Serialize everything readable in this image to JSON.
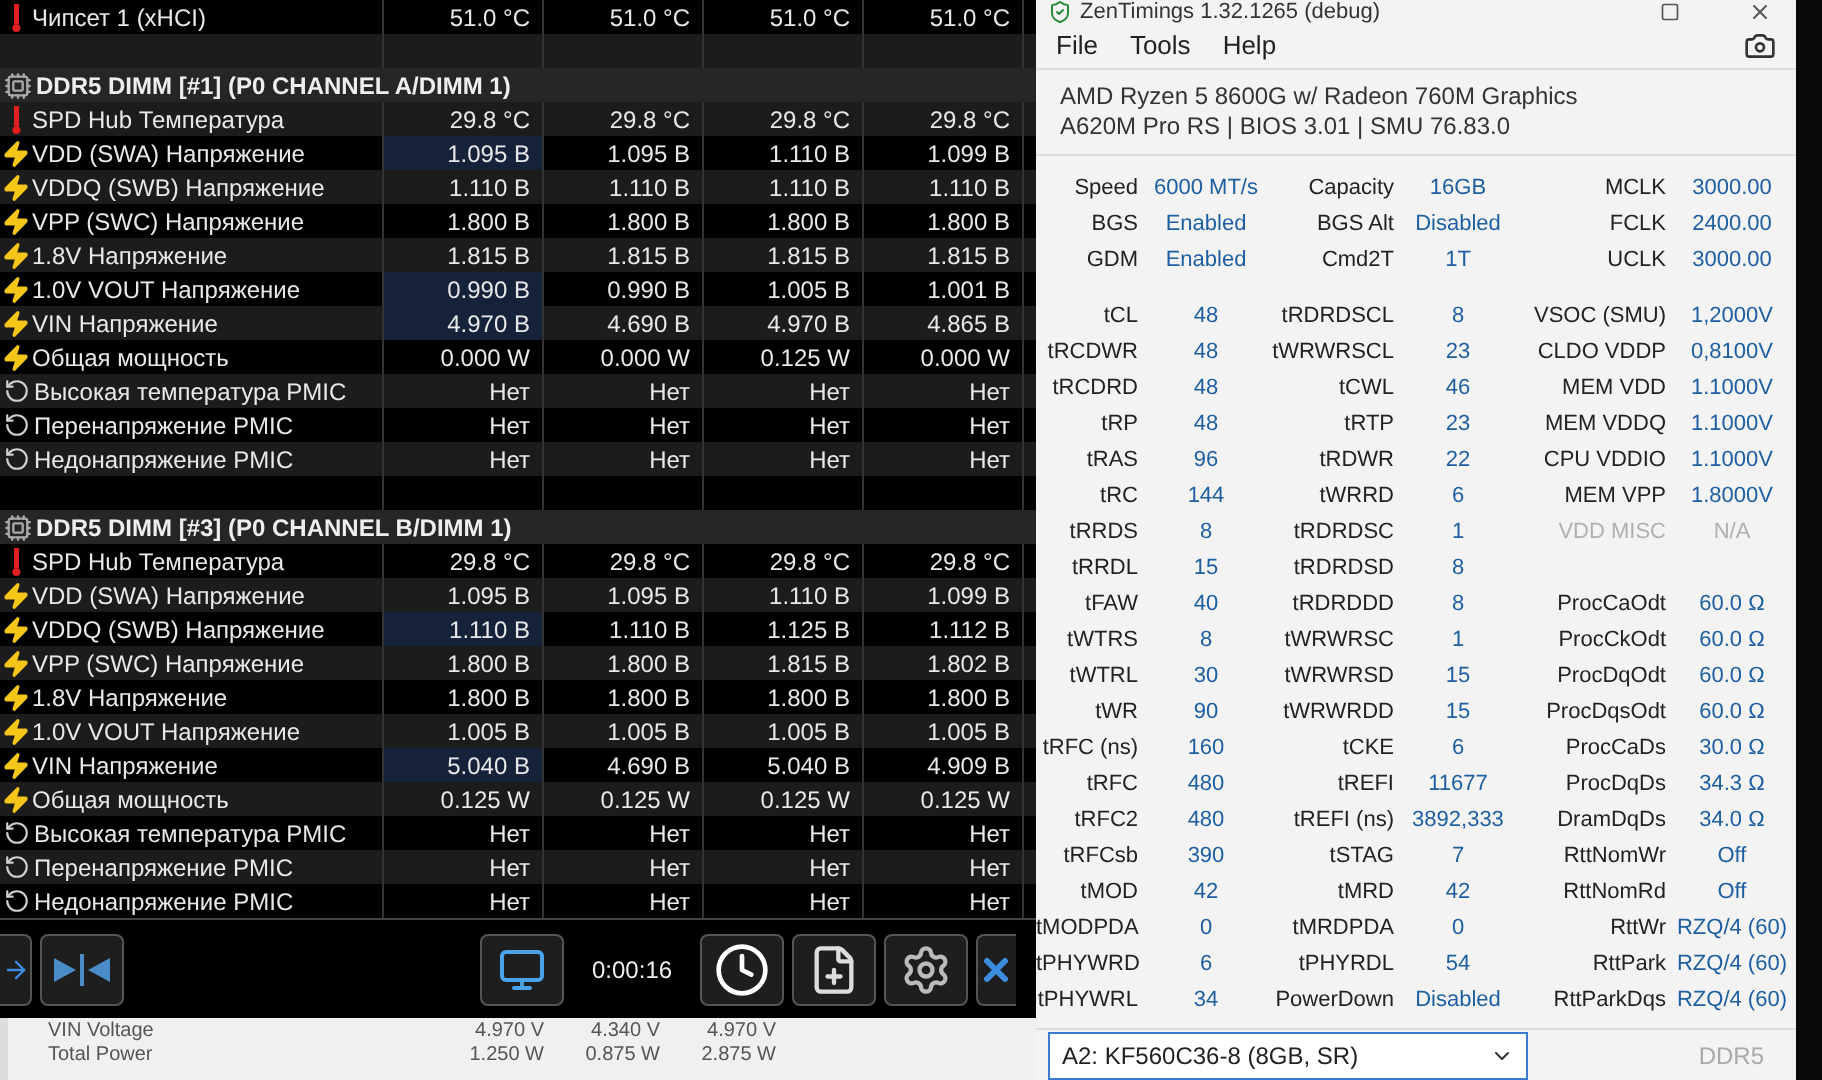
{
  "sensors": {
    "rows": [
      {
        "kind": "temperature",
        "label": "Чипсет 1 (xHCI)",
        "values": [
          "51.0 °C",
          "51.0 °C",
          "51.0 °C",
          "51.0 °C"
        ],
        "highlighted": false
      },
      {
        "kind": "blank"
      },
      {
        "kind": "group",
        "label": "DDR5 DIMM [#1] (P0 CHANNEL A/DIMM 1)"
      },
      {
        "kind": "temperature",
        "label": "SPD Hub Температура",
        "values": [
          "29.8 °C",
          "29.8 °C",
          "29.8 °C",
          "29.8 °C"
        ],
        "highlighted": false
      },
      {
        "kind": "voltage",
        "label": "VDD (SWA) Напряжение",
        "values": [
          "1.095 В",
          "1.095 В",
          "1.110 В",
          "1.099 В"
        ],
        "highlighted": true
      },
      {
        "kind": "voltage",
        "label": "VDDQ (SWB) Напряжение",
        "values": [
          "1.110 В",
          "1.110 В",
          "1.110 В",
          "1.110 В"
        ],
        "highlighted": false
      },
      {
        "kind": "voltage",
        "label": "VPP (SWC) Напряжение",
        "values": [
          "1.800 В",
          "1.800 В",
          "1.800 В",
          "1.800 В"
        ],
        "highlighted": false
      },
      {
        "kind": "voltage",
        "label": "1.8V Напряжение",
        "values": [
          "1.815 В",
          "1.815 В",
          "1.815 В",
          "1.815 В"
        ],
        "highlighted": false
      },
      {
        "kind": "voltage",
        "label": "1.0V VOUT Напряжение",
        "values": [
          "0.990 В",
          "0.990 В",
          "1.005 В",
          "1.001 В"
        ],
        "highlighted": true
      },
      {
        "kind": "voltage",
        "label": "VIN Напряжение",
        "values": [
          "4.970 В",
          "4.690 В",
          "4.970 В",
          "4.865 В"
        ],
        "highlighted": true
      },
      {
        "kind": "voltage",
        "label": "Общая мощность",
        "values": [
          "0.000 W",
          "0.000 W",
          "0.125 W",
          "0.000 W"
        ],
        "highlighted": false
      },
      {
        "kind": "alert",
        "label": "Высокая температура PMIC",
        "values": [
          "Нет",
          "Нет",
          "Нет",
          "Нет"
        ],
        "highlighted": false
      },
      {
        "kind": "alert",
        "label": "Перенапряжение PMIC",
        "values": [
          "Нет",
          "Нет",
          "Нет",
          "Нет"
        ],
        "highlighted": false
      },
      {
        "kind": "alert",
        "label": "Недонапряжение PMIC",
        "values": [
          "Нет",
          "Нет",
          "Нет",
          "Нет"
        ],
        "highlighted": false
      },
      {
        "kind": "blank"
      },
      {
        "kind": "group",
        "label": "DDR5 DIMM [#3] (P0 CHANNEL B/DIMM 1)"
      },
      {
        "kind": "temperature",
        "label": "SPD Hub Температура",
        "values": [
          "29.8 °C",
          "29.8 °C",
          "29.8 °C",
          "29.8 °C"
        ],
        "highlighted": false
      },
      {
        "kind": "voltage",
        "label": "VDD (SWA) Напряжение",
        "values": [
          "1.095 В",
          "1.095 В",
          "1.110 В",
          "1.099 В"
        ],
        "highlighted": false
      },
      {
        "kind": "voltage",
        "label": "VDDQ (SWB) Напряжение",
        "values": [
          "1.110 В",
          "1.110 В",
          "1.125 В",
          "1.112 В"
        ],
        "highlighted": true
      },
      {
        "kind": "voltage",
        "label": "VPP (SWC) Напряжение",
        "values": [
          "1.800 В",
          "1.800 В",
          "1.815 В",
          "1.802 В"
        ],
        "highlighted": false
      },
      {
        "kind": "voltage",
        "label": "1.8V Напряжение",
        "values": [
          "1.800 В",
          "1.800 В",
          "1.800 В",
          "1.800 В"
        ],
        "highlighted": false
      },
      {
        "kind": "voltage",
        "label": "1.0V VOUT Напряжение",
        "values": [
          "1.005 В",
          "1.005 В",
          "1.005 В",
          "1.005 В"
        ],
        "highlighted": false
      },
      {
        "kind": "voltage",
        "label": "VIN Напряжение",
        "values": [
          "5.040 В",
          "4.690 В",
          "5.040 В",
          "4.909 В"
        ],
        "highlighted": true
      },
      {
        "kind": "voltage",
        "label": "Общая мощность",
        "values": [
          "0.125 W",
          "0.125 W",
          "0.125 W",
          "0.125 W"
        ],
        "highlighted": false
      },
      {
        "kind": "alert",
        "label": "Высокая температура PMIC",
        "values": [
          "Нет",
          "Нет",
          "Нет",
          "Нет"
        ],
        "highlighted": false
      },
      {
        "kind": "alert",
        "label": "Перенапряжение PMIC",
        "values": [
          "Нет",
          "Нет",
          "Нет",
          "Нет"
        ],
        "highlighted": false
      },
      {
        "kind": "alert",
        "label": "Недонапряжение PMIC",
        "values": [
          "Нет",
          "Нет",
          "Нет",
          "Нет"
        ],
        "highlighted": false
      }
    ]
  },
  "toolbar": {
    "elapsed": "0:00:16"
  },
  "background_sheet": {
    "rows": [
      {
        "label": "VIN Voltage",
        "values": [
          "4.970 V",
          "4.340 V",
          "4.970 V"
        ]
      },
      {
        "label": "Total Power",
        "values": [
          "1.250 W",
          "0.875 W",
          "2.875 W"
        ]
      }
    ]
  },
  "zentimings": {
    "title": "ZenTimings 1.32.1265 (debug)",
    "menu": [
      "File",
      "Tools",
      "Help"
    ],
    "info": [
      "AMD Ryzen 5 8600G w/ Radeon 760M Graphics",
      "A620M Pro RS | BIOS 3.01 | SMU 76.83.0"
    ],
    "summary": [
      [
        {
          "label": "Speed",
          "value": "6000 MT/s"
        },
        {
          "label": "Capacity",
          "value": "16GB"
        },
        {
          "label": "MCLK",
          "value": "3000.00"
        }
      ],
      [
        {
          "label": "BGS",
          "value": "Enabled"
        },
        {
          "label": "BGS Alt",
          "value": "Disabled"
        },
        {
          "label": "FCLK",
          "value": "2400.00"
        }
      ],
      [
        {
          "label": "GDM",
          "value": "Enabled"
        },
        {
          "label": "Cmd2T",
          "value": "1T"
        },
        {
          "label": "UCLK",
          "value": "3000.00"
        }
      ]
    ],
    "timings": [
      [
        {
          "label": "tCL",
          "value": "48"
        },
        {
          "label": "tRDRDSCL",
          "value": "8"
        },
        {
          "label": "VSOC (SMU)",
          "value": "1,2000V",
          "disabled": false
        }
      ],
      [
        {
          "label": "tRCDWR",
          "value": "48"
        },
        {
          "label": "tWRWRSCL",
          "value": "23"
        },
        {
          "label": "CLDO VDDP",
          "value": "0,8100V",
          "disabled": false
        }
      ],
      [
        {
          "label": "tRCDRD",
          "value": "48"
        },
        {
          "label": "tCWL",
          "value": "46"
        },
        {
          "label": "MEM VDD",
          "value": "1.1000V",
          "disabled": false
        }
      ],
      [
        {
          "label": "tRP",
          "value": "48"
        },
        {
          "label": "tRTP",
          "value": "23"
        },
        {
          "label": "MEM VDDQ",
          "value": "1.1000V",
          "disabled": false
        }
      ],
      [
        {
          "label": "tRAS",
          "value": "96"
        },
        {
          "label": "tRDWR",
          "value": "22"
        },
        {
          "label": "CPU VDDIO",
          "value": "1.1000V",
          "disabled": false
        }
      ],
      [
        {
          "label": "tRC",
          "value": "144"
        },
        {
          "label": "tWRRD",
          "value": "6"
        },
        {
          "label": "MEM VPP",
          "value": "1.8000V",
          "disabled": false
        }
      ],
      [
        {
          "label": "tRRDS",
          "value": "8"
        },
        {
          "label": "tRDRDSC",
          "value": "1"
        },
        {
          "label": "VDD MISC",
          "value": "N/A",
          "disabled": true
        }
      ],
      [
        {
          "label": "tRRDL",
          "value": "15"
        },
        {
          "label": "tRDRDSD",
          "value": "8"
        }
      ],
      [
        {
          "label": "tFAW",
          "value": "40"
        },
        {
          "label": "tRDRDDD",
          "value": "8"
        },
        {
          "label": "ProcCaOdt",
          "value": "60.0 Ω",
          "disabled": false
        }
      ],
      [
        {
          "label": "tWTRS",
          "value": "8"
        },
        {
          "label": "tWRWRSC",
          "value": "1"
        },
        {
          "label": "ProcCkOdt",
          "value": "60.0 Ω",
          "disabled": false
        }
      ],
      [
        {
          "label": "tWTRL",
          "value": "30"
        },
        {
          "label": "tWRWRSD",
          "value": "15"
        },
        {
          "label": "ProcDqOdt",
          "value": "60.0 Ω",
          "disabled": false
        }
      ],
      [
        {
          "label": "tWR",
          "value": "90"
        },
        {
          "label": "tWRWRDD",
          "value": "15"
        },
        {
          "label": "ProcDqsOdt",
          "value": "60.0 Ω",
          "disabled": false
        }
      ],
      [
        {
          "label": "tRFC (ns)",
          "value": "160"
        },
        {
          "label": "tCKE",
          "value": "6"
        },
        {
          "label": "ProcCaDs",
          "value": "30.0 Ω",
          "disabled": false
        }
      ],
      [
        {
          "label": "tRFC",
          "value": "480"
        },
        {
          "label": "tREFI",
          "value": "11677"
        },
        {
          "label": "ProcDqDs",
          "value": "34.3 Ω",
          "disabled": false
        }
      ],
      [
        {
          "label": "tRFC2",
          "value": "480"
        },
        {
          "label": "tREFI (ns)",
          "value": "3892,333"
        },
        {
          "label": "DramDqDs",
          "value": "34.0 Ω",
          "disabled": false
        }
      ],
      [
        {
          "label": "tRFCsb",
          "value": "390"
        },
        {
          "label": "tSTAG",
          "value": "7"
        },
        {
          "label": "RttNomWr",
          "value": "Off",
          "disabled": false
        }
      ],
      [
        {
          "label": "tMOD",
          "value": "42"
        },
        {
          "label": "tMRD",
          "value": "42"
        },
        {
          "label": "RttNomRd",
          "value": "Off",
          "disabled": false
        }
      ],
      [
        {
          "label": "tMODPDA",
          "value": "0"
        },
        {
          "label": "tMRDPDA",
          "value": "0"
        },
        {
          "label": "RttWr",
          "value": "RZQ/4 (60)",
          "disabled": false
        }
      ],
      [
        {
          "label": "tPHYWRD",
          "value": "6"
        },
        {
          "label": "tPHYRDL",
          "value": "54"
        },
        {
          "label": "RttPark",
          "value": "RZQ/4 (60)",
          "disabled": false
        }
      ],
      [
        {
          "label": "tPHYWRL",
          "value": "34"
        },
        {
          "label": "PowerDown",
          "value": "Disabled"
        },
        {
          "label": "RttParkDqs",
          "value": "RZQ/4 (60)",
          "disabled": false
        }
      ]
    ],
    "module": {
      "value": "A2: KF560C36-8 (8GB, SR)"
    },
    "memory_type": "DDR5"
  }
}
